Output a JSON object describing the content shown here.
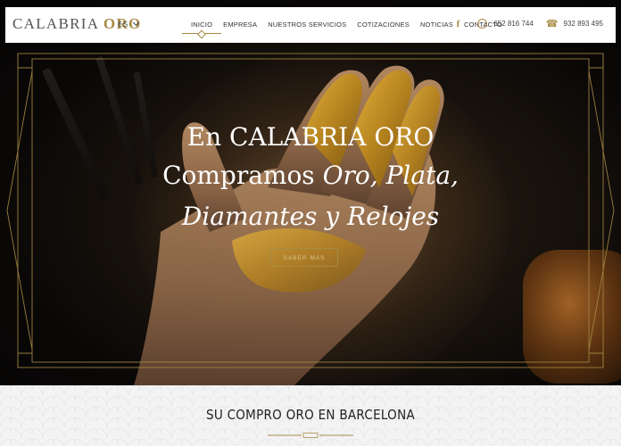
{
  "header": {
    "logo_main": "CALABRIA",
    "logo_accent": "ORO",
    "language": "ES",
    "nav": [
      {
        "label": "INICIO",
        "active": true
      },
      {
        "label": "EMPRESA"
      },
      {
        "label": "NUESTROS SERVICIOS"
      },
      {
        "label": "COTIZACIONES"
      },
      {
        "label": "NOTICIAS"
      },
      {
        "label": "CONTACTO"
      }
    ],
    "facebook_icon": "f",
    "whatsapp_number": "652 816 744",
    "phone_number": "932 893 495"
  },
  "hero": {
    "line1": "En CALABRIA ORO",
    "line2_plain": "Compramos ",
    "line2_italic": "Oro, Plata,",
    "line3_italic": "Diamantes y Relojes",
    "cta_label": "SABER MÁS"
  },
  "section": {
    "heading": "SU COMPRO ORO EN BARCELONA"
  },
  "colors": {
    "accent_gold": "#a88b44",
    "header_bg": "#ffffff",
    "section_bg": "#f3f3f4"
  }
}
